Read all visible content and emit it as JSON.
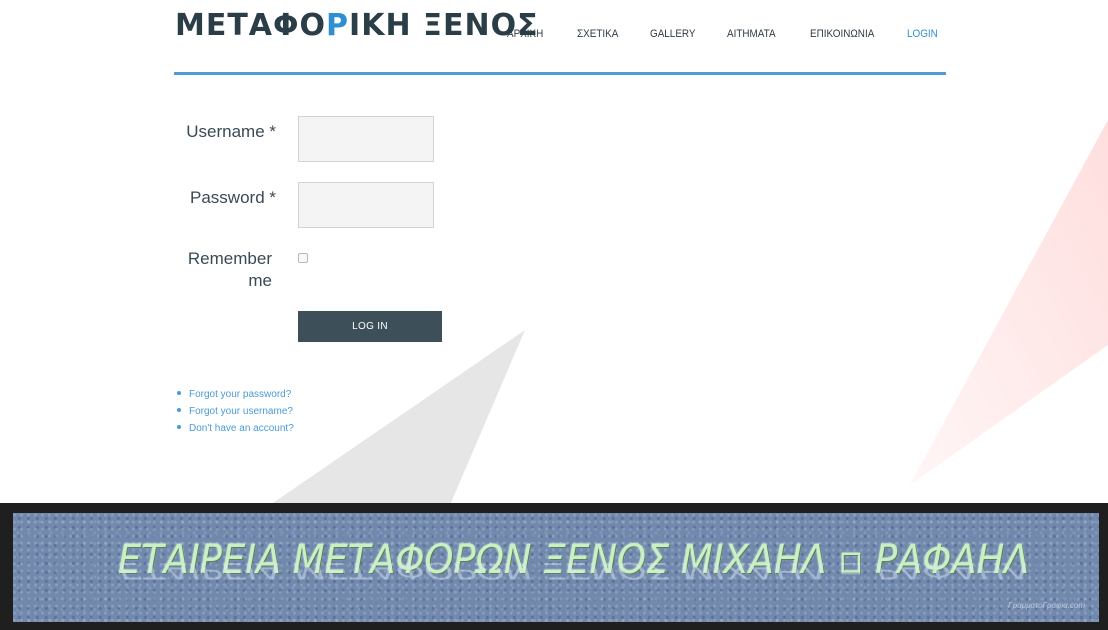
{
  "site": {
    "logo_part1": "ΜΕΤΑΦΟ",
    "logo_accent": "Ρ",
    "logo_part2": "ΙΚΗ ΞΕΝΟΣ"
  },
  "nav": {
    "items": [
      {
        "label": "ΑΡΧΙΚΗ"
      },
      {
        "label": "ΣΧΕΤΙΚΑ"
      },
      {
        "label": "GALLERY"
      },
      {
        "label": "ΑΙΤΗΜΑΤΑ"
      },
      {
        "label": "ΕΠΙΚΟΙΝΩΝΙΑ"
      },
      {
        "label": "LOGIN"
      }
    ],
    "active": "LOGIN"
  },
  "form": {
    "username_label": "Username *",
    "password_label": "Password *",
    "remember_label": "Remember me",
    "username_value": "",
    "password_value": "",
    "remember_checked": false,
    "submit_label": "LOG IN"
  },
  "links": [
    {
      "label": "Forgot your password?"
    },
    {
      "label": "Forgot your username?"
    },
    {
      "label": "Don't have an account?"
    }
  ],
  "banner": {
    "text": "ΕΤΑΙΡΕΙΑ ΜΕΤΑΦΟΡΩΝ ΞΕΝΟΣ ΜΙΧΑΗΛ ▫ ΡΑΦΑΗΛ",
    "watermark": "ΓραμματοΓραφια.com"
  },
  "colors": {
    "accent": "#2f8fd1",
    "button": "#3d5059",
    "banner_bg": "#7189ad",
    "banner_text": "#c9f0c4"
  }
}
